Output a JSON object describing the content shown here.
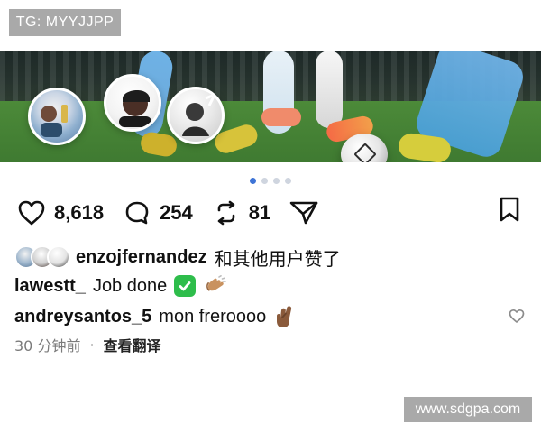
{
  "watermarks": {
    "top": "TG: MYYJJPP",
    "bottom": "www.sdgpa.com"
  },
  "carousel": {
    "total": 4,
    "active_index": 0
  },
  "actions": {
    "likes": "8,618",
    "comments": "254",
    "reposts": "81"
  },
  "likes_summary": {
    "username": "enzojfernandez",
    "suffix": "和其他用户赞了"
  },
  "comments": [
    {
      "username": "lawestt_",
      "text": "Job done",
      "emojis": [
        "check-mark-button",
        "clapping-hands"
      ]
    },
    {
      "username": "andreysantos_5",
      "text": "mon freroooo",
      "emojis": [
        "crossed-fingers"
      ]
    }
  ],
  "meta": {
    "time": "30 分钟前",
    "separator": "·",
    "translate": "查看翻译"
  },
  "colors": {
    "accent_dot": "#3e74d6",
    "heart_pink": "#ff5aa8",
    "watermark_bg": "#a9a9a9",
    "meta_gray": "#7b7b7b"
  },
  "icons": {
    "like": "heart-outline",
    "comment": "speech-bubble",
    "repost": "repeat-arrows",
    "send": "send-paper-plane",
    "save": "bookmark",
    "comment_like": "heart-outline-small"
  }
}
